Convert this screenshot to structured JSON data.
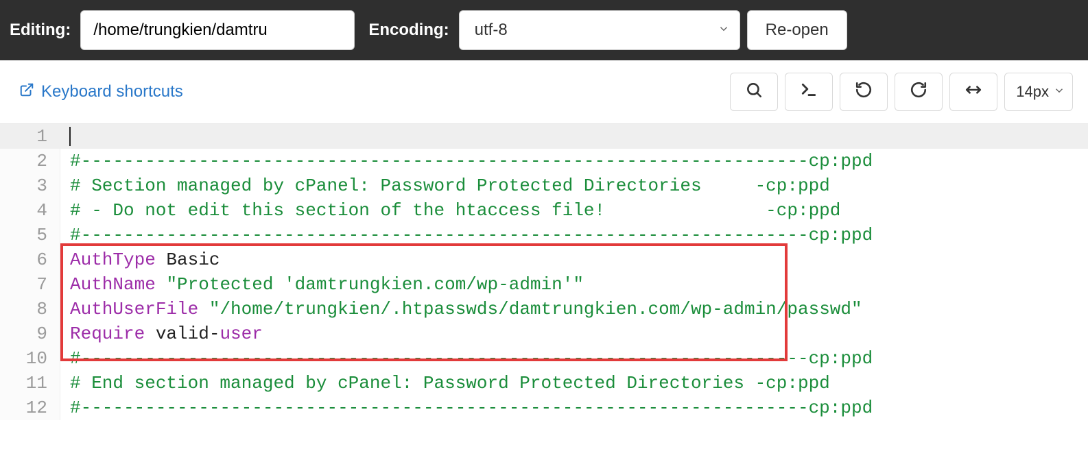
{
  "topbar": {
    "editing_label": "Editing:",
    "file_path": "/home/trungkien/damtru",
    "encoding_label": "Encoding:",
    "encoding_value": "utf-8",
    "reopen_label": "Re-open"
  },
  "secondbar": {
    "keyboard_shortcuts": "Keyboard shortcuts",
    "font_size": "14px"
  },
  "code_lines": [
    {
      "n": 1,
      "segments": []
    },
    {
      "n": 2,
      "segments": [
        {
          "cls": "tk-comment",
          "t": "#--------------------------------------------------------------------cp:ppd"
        }
      ]
    },
    {
      "n": 3,
      "segments": [
        {
          "cls": "tk-comment",
          "t": "# Section managed by cPanel: Password Protected Directories     -cp:ppd"
        }
      ]
    },
    {
      "n": 4,
      "segments": [
        {
          "cls": "tk-comment",
          "t": "# - Do not edit this section of the htaccess file!               -cp:ppd"
        }
      ]
    },
    {
      "n": 5,
      "segments": [
        {
          "cls": "tk-comment",
          "t": "#--------------------------------------------------------------------cp:ppd"
        }
      ]
    },
    {
      "n": 6,
      "segments": [
        {
          "cls": "tk-key",
          "t": "AuthType"
        },
        {
          "cls": "tk-plain",
          "t": " Basic"
        }
      ]
    },
    {
      "n": 7,
      "segments": [
        {
          "cls": "tk-key",
          "t": "AuthName"
        },
        {
          "cls": "tk-plain",
          "t": " "
        },
        {
          "cls": "tk-string",
          "t": "\"Protected 'damtrungkien.com/wp-admin'\""
        }
      ]
    },
    {
      "n": 8,
      "segments": [
        {
          "cls": "tk-key",
          "t": "AuthUserFile"
        },
        {
          "cls": "tk-plain",
          "t": " "
        },
        {
          "cls": "tk-string",
          "t": "\"/home/trungkien/.htpasswds/damtrungkien.com/wp-admin/passwd\""
        }
      ]
    },
    {
      "n": 9,
      "segments": [
        {
          "cls": "tk-key",
          "t": "Require"
        },
        {
          "cls": "tk-plain",
          "t": " valid-"
        },
        {
          "cls": "tk-user",
          "t": "user"
        }
      ]
    },
    {
      "n": 10,
      "segments": [
        {
          "cls": "tk-comment",
          "t": "#--------------------------------------------------------------------cp:ppd"
        }
      ]
    },
    {
      "n": 11,
      "segments": [
        {
          "cls": "tk-comment",
          "t": "# End section managed by cPanel: Password Protected Directories -cp:ppd"
        }
      ]
    },
    {
      "n": 12,
      "segments": [
        {
          "cls": "tk-comment",
          "t": "#--------------------------------------------------------------------cp:ppd"
        }
      ]
    }
  ]
}
